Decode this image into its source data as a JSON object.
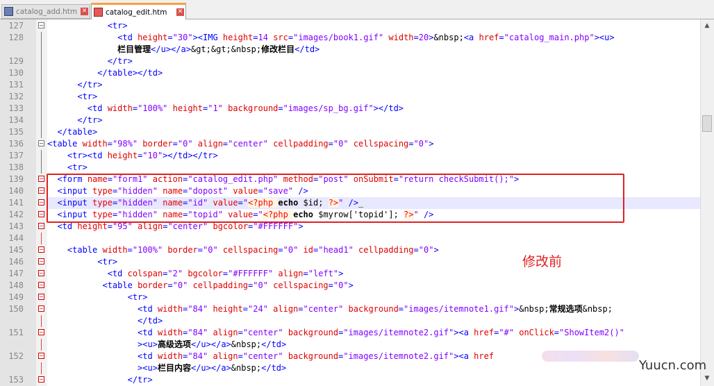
{
  "tabs": [
    {
      "label": "catalog_add.htm",
      "icon": "file-saved-icon",
      "active": false
    },
    {
      "label": "catalog_edit.htm",
      "icon": "file-modified-icon",
      "active": true
    }
  ],
  "lines": [
    {
      "n": "127",
      "tokens": [
        [
          "",
          "            "
        ],
        [
          "t",
          "<tr>"
        ]
      ]
    },
    {
      "n": "128",
      "tokens": [
        [
          "",
          "              "
        ],
        [
          "t",
          "<td "
        ],
        [
          "a",
          "height"
        ],
        [
          "t",
          "="
        ],
        [
          "s",
          "\"30\""
        ],
        [
          "t",
          "><IMG "
        ],
        [
          "a",
          "height"
        ],
        [
          "t",
          "="
        ],
        [
          "s",
          "14 "
        ],
        [
          "a",
          "src"
        ],
        [
          "t",
          "="
        ],
        [
          "s",
          "\"images/book1.gif\" "
        ],
        [
          "a",
          "width"
        ],
        [
          "t",
          "="
        ],
        [
          "s",
          "20"
        ],
        [
          "t",
          ">"
        ],
        [
          "e",
          "&nbsp;"
        ],
        [
          "t",
          "<a "
        ],
        [
          "a",
          "href"
        ],
        [
          "t",
          "="
        ],
        [
          "s",
          "\"catalog_main.php\""
        ],
        [
          "t",
          "><u>"
        ]
      ]
    },
    {
      "n": "",
      "tokens": [
        [
          "",
          "              "
        ],
        [
          "k",
          "栏目管理"
        ],
        [
          "t",
          "</u></a>"
        ],
        [
          "e",
          "&gt;&gt;&nbsp;"
        ],
        [
          "k",
          "修改栏目"
        ],
        [
          "t",
          "</td>"
        ]
      ]
    },
    {
      "n": "129",
      "tokens": [
        [
          "",
          "            "
        ],
        [
          "t",
          "</tr>"
        ]
      ]
    },
    {
      "n": "130",
      "tokens": [
        [
          "",
          "          "
        ],
        [
          "t",
          "</table></td>"
        ]
      ]
    },
    {
      "n": "131",
      "tokens": [
        [
          "",
          "      "
        ],
        [
          "t",
          "</tr>"
        ]
      ]
    },
    {
      "n": "132",
      "tokens": [
        [
          "",
          "      "
        ],
        [
          "t",
          "<tr>"
        ]
      ]
    },
    {
      "n": "133",
      "tokens": [
        [
          "",
          "        "
        ],
        [
          "t",
          "<td "
        ],
        [
          "a",
          "width"
        ],
        [
          "t",
          "="
        ],
        [
          "s",
          "\"100%\" "
        ],
        [
          "a",
          "height"
        ],
        [
          "t",
          "="
        ],
        [
          "s",
          "\"1\" "
        ],
        [
          "a",
          "background"
        ],
        [
          "t",
          "="
        ],
        [
          "s",
          "\"images/sp_bg.gif\""
        ],
        [
          "t",
          "></td>"
        ]
      ]
    },
    {
      "n": "134",
      "tokens": [
        [
          "",
          "      "
        ],
        [
          "t",
          "</tr>"
        ]
      ]
    },
    {
      "n": "135",
      "tokens": [
        [
          "",
          "  "
        ],
        [
          "t",
          "</table>"
        ]
      ]
    },
    {
      "n": "136",
      "tokens": [
        [
          "t",
          "<table "
        ],
        [
          "a",
          "width"
        ],
        [
          "t",
          "="
        ],
        [
          "s",
          "\"98%\" "
        ],
        [
          "a",
          "border"
        ],
        [
          "t",
          "="
        ],
        [
          "s",
          "\"0\" "
        ],
        [
          "a",
          "align"
        ],
        [
          "t",
          "="
        ],
        [
          "s",
          "\"center\" "
        ],
        [
          "a",
          "cellpadding"
        ],
        [
          "t",
          "="
        ],
        [
          "s",
          "\"0\" "
        ],
        [
          "a",
          "cellspacing"
        ],
        [
          "t",
          "="
        ],
        [
          "s",
          "\"0\""
        ],
        [
          "t",
          ">"
        ]
      ]
    },
    {
      "n": "137",
      "tokens": [
        [
          "",
          "    "
        ],
        [
          "t",
          "<tr><td "
        ],
        [
          "a",
          "height"
        ],
        [
          "t",
          "="
        ],
        [
          "s",
          "\"10\""
        ],
        [
          "t",
          "></td></tr>"
        ]
      ]
    },
    {
      "n": "138",
      "tokens": [
        [
          "",
          "    "
        ],
        [
          "t",
          "<tr>"
        ]
      ]
    },
    {
      "n": "139",
      "tokens": [
        [
          "",
          "  "
        ],
        [
          "t",
          "<form "
        ],
        [
          "a",
          "name"
        ],
        [
          "t",
          "="
        ],
        [
          "s",
          "\"form1\" "
        ],
        [
          "a",
          "action"
        ],
        [
          "t",
          "="
        ],
        [
          "s",
          "\"catalog_edit.php\" "
        ],
        [
          "a",
          "method"
        ],
        [
          "t",
          "="
        ],
        [
          "s",
          "\"post\" "
        ],
        [
          "a",
          "onSubmit"
        ],
        [
          "t",
          "="
        ],
        [
          "s",
          "\"return checkSubmit();\""
        ],
        [
          "t",
          ">"
        ]
      ]
    },
    {
      "n": "140",
      "tokens": [
        [
          "",
          "  "
        ],
        [
          "t",
          "<input "
        ],
        [
          "a",
          "type"
        ],
        [
          "t",
          "="
        ],
        [
          "s",
          "\"hidden\" "
        ],
        [
          "a",
          "name"
        ],
        [
          "t",
          "="
        ],
        [
          "s",
          "\"dopost\" "
        ],
        [
          "a",
          "value"
        ],
        [
          "t",
          "="
        ],
        [
          "s",
          "\"save\" "
        ],
        [
          "t",
          "/>"
        ]
      ]
    },
    {
      "n": "141",
      "tokens": [
        [
          "",
          "  "
        ],
        [
          "t",
          "<input "
        ],
        [
          "a",
          "type"
        ],
        [
          "t",
          "="
        ],
        [
          "s",
          "\"hidden\" "
        ],
        [
          "a",
          "name"
        ],
        [
          "t",
          "="
        ],
        [
          "s",
          "\"id\" "
        ],
        [
          "a",
          "value"
        ],
        [
          "t",
          "="
        ],
        [
          "s",
          "\""
        ],
        [
          "ph",
          "<?php "
        ],
        [
          "k",
          "echo"
        ],
        [
          "n",
          " $id; "
        ],
        [
          "ph",
          "?>"
        ],
        [
          "s",
          "\" "
        ],
        [
          "t",
          "/>"
        ],
        [
          "n",
          "_"
        ]
      ]
    },
    {
      "n": "142",
      "tokens": [
        [
          "",
          "  "
        ],
        [
          "t",
          "<input "
        ],
        [
          "a",
          "type"
        ],
        [
          "t",
          "="
        ],
        [
          "s",
          "\"hidden\" "
        ],
        [
          "a",
          "name"
        ],
        [
          "t",
          "="
        ],
        [
          "s",
          "\"topid\" "
        ],
        [
          "a",
          "value"
        ],
        [
          "t",
          "="
        ],
        [
          "s",
          "\""
        ],
        [
          "ph",
          "<?php "
        ],
        [
          "k",
          "echo"
        ],
        [
          "n",
          " $myrow['topid']; "
        ],
        [
          "ph",
          "?>"
        ],
        [
          "s",
          "\" "
        ],
        [
          "t",
          "/>"
        ]
      ]
    },
    {
      "n": "143",
      "tokens": [
        [
          "",
          "  "
        ],
        [
          "t",
          "<td "
        ],
        [
          "a",
          "height"
        ],
        [
          "t",
          "="
        ],
        [
          "s",
          "\"95\" "
        ],
        [
          "a",
          "align"
        ],
        [
          "t",
          "="
        ],
        [
          "s",
          "\"center\" "
        ],
        [
          "a",
          "bgcolor"
        ],
        [
          "t",
          "="
        ],
        [
          "s",
          "\"#FFFFFF\""
        ],
        [
          "t",
          ">"
        ]
      ]
    },
    {
      "n": "144",
      "tokens": []
    },
    {
      "n": "145",
      "tokens": [
        [
          "",
          "    "
        ],
        [
          "t",
          "<table "
        ],
        [
          "a",
          "width"
        ],
        [
          "t",
          "="
        ],
        [
          "s",
          "\"100%\" "
        ],
        [
          "a",
          "border"
        ],
        [
          "t",
          "="
        ],
        [
          "s",
          "\"0\" "
        ],
        [
          "a",
          "cellspacing"
        ],
        [
          "t",
          "="
        ],
        [
          "s",
          "\"0\" "
        ],
        [
          "a",
          "id"
        ],
        [
          "t",
          "="
        ],
        [
          "s",
          "\"head1\" "
        ],
        [
          "a",
          "cellpadding"
        ],
        [
          "t",
          "="
        ],
        [
          "s",
          "\"0\""
        ],
        [
          "t",
          ">"
        ]
      ]
    },
    {
      "n": "146",
      "tokens": [
        [
          "",
          "          "
        ],
        [
          "t",
          "<tr>"
        ]
      ]
    },
    {
      "n": "147",
      "tokens": [
        [
          "",
          "            "
        ],
        [
          "t",
          "<td "
        ],
        [
          "a",
          "colspan"
        ],
        [
          "t",
          "="
        ],
        [
          "s",
          "\"2\" "
        ],
        [
          "a",
          "bgcolor"
        ],
        [
          "t",
          "="
        ],
        [
          "s",
          "\"#FFFFFF\" "
        ],
        [
          "a",
          "align"
        ],
        [
          "t",
          "="
        ],
        [
          "s",
          "\"left\""
        ],
        [
          "t",
          ">"
        ]
      ]
    },
    {
      "n": "148",
      "tokens": [
        [
          "",
          "           "
        ],
        [
          "t",
          "<table "
        ],
        [
          "a",
          "border"
        ],
        [
          "t",
          "="
        ],
        [
          "s",
          "\"0\" "
        ],
        [
          "a",
          "cellpadding"
        ],
        [
          "t",
          "="
        ],
        [
          "s",
          "\"0\" "
        ],
        [
          "a",
          "cellspacing"
        ],
        [
          "t",
          "="
        ],
        [
          "s",
          "\"0\""
        ],
        [
          "t",
          ">"
        ]
      ]
    },
    {
      "n": "149",
      "tokens": [
        [
          "",
          "                "
        ],
        [
          "t",
          "<tr>"
        ]
      ]
    },
    {
      "n": "150",
      "tokens": [
        [
          "",
          "                  "
        ],
        [
          "t",
          "<td "
        ],
        [
          "a",
          "width"
        ],
        [
          "t",
          "="
        ],
        [
          "s",
          "\"84\" "
        ],
        [
          "a",
          "height"
        ],
        [
          "t",
          "="
        ],
        [
          "s",
          "\"24\" "
        ],
        [
          "a",
          "align"
        ],
        [
          "t",
          "="
        ],
        [
          "s",
          "\"center\" "
        ],
        [
          "a",
          "background"
        ],
        [
          "t",
          "="
        ],
        [
          "s",
          "\"images/itemnote1.gif\""
        ],
        [
          "t",
          ">"
        ],
        [
          "e",
          "&nbsp;"
        ],
        [
          "k",
          "常规选项"
        ],
        [
          "e",
          "&nbsp;"
        ]
      ]
    },
    {
      "n": "",
      "tokens": [
        [
          "",
          "                  "
        ],
        [
          "t",
          "</td>"
        ]
      ]
    },
    {
      "n": "151",
      "tokens": [
        [
          "",
          "                  "
        ],
        [
          "t",
          "<td "
        ],
        [
          "a",
          "width"
        ],
        [
          "t",
          "="
        ],
        [
          "s",
          "\"84\" "
        ],
        [
          "a",
          "align"
        ],
        [
          "t",
          "="
        ],
        [
          "s",
          "\"center\" "
        ],
        [
          "a",
          "background"
        ],
        [
          "t",
          "="
        ],
        [
          "s",
          "\"images/itemnote2.gif\""
        ],
        [
          "t",
          "><a "
        ],
        [
          "a",
          "href"
        ],
        [
          "t",
          "="
        ],
        [
          "s",
          "\"#\" "
        ],
        [
          "a",
          "onClick"
        ],
        [
          "t",
          "="
        ],
        [
          "s",
          "\"ShowItem2()\""
        ]
      ]
    },
    {
      "n": "",
      "tokens": [
        [
          "",
          "                  "
        ],
        [
          "t",
          "><u>"
        ],
        [
          "k",
          "高级选项"
        ],
        [
          "t",
          "</u></a>"
        ],
        [
          "e",
          "&nbsp;"
        ],
        [
          "t",
          "</td>"
        ]
      ]
    },
    {
      "n": "152",
      "tokens": [
        [
          "",
          "                  "
        ],
        [
          "t",
          "<td "
        ],
        [
          "a",
          "width"
        ],
        [
          "t",
          "="
        ],
        [
          "s",
          "\"84\" "
        ],
        [
          "a",
          "align"
        ],
        [
          "t",
          "="
        ],
        [
          "s",
          "\"center\" "
        ],
        [
          "a",
          "background"
        ],
        [
          "t",
          "="
        ],
        [
          "s",
          "\"images/itemnote2.gif\""
        ],
        [
          "t",
          "><a "
        ],
        [
          "a",
          "href"
        ]
      ]
    },
    {
      "n": "",
      "tokens": [
        [
          "",
          "                  "
        ],
        [
          "t",
          "><u>"
        ],
        [
          "k",
          "栏目内容"
        ],
        [
          "t",
          "</u></a>"
        ],
        [
          "e",
          "&nbsp;"
        ],
        [
          "t",
          "</td>"
        ]
      ]
    },
    {
      "n": "153",
      "tokens": [
        [
          "",
          "                "
        ],
        [
          "t",
          "</tr>"
        ]
      ]
    }
  ],
  "highlight_line": "141",
  "annotation_label": "修改前",
  "watermark": "Yuucn.com",
  "scrollbar": {
    "up": "▲",
    "down": "▼"
  },
  "colors": {
    "tag": "#0000ff",
    "attr": "#e00000",
    "value": "#8000ff",
    "annotation": "#e02020",
    "tab_accent": "#f7a23e"
  }
}
